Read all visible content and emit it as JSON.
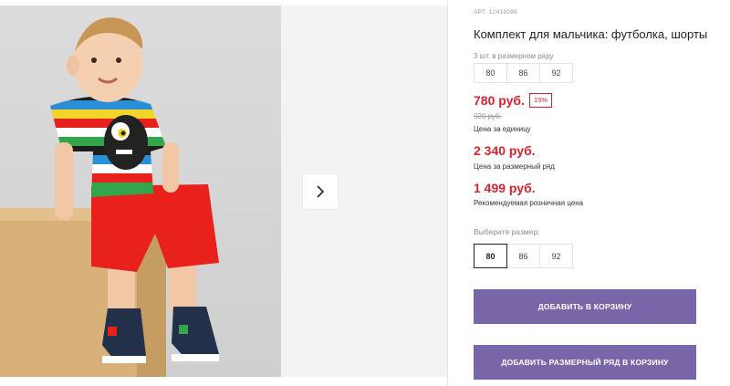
{
  "gallery": {
    "photo_alt": "Boy in striped monster t-shirt and red shorts",
    "next_icon": "chevron-right-icon"
  },
  "product": {
    "article": "АРТ. 12419098",
    "title": "Комплект для мальчика: футболка, шорты"
  },
  "size_row": {
    "caption": "3 шт. в размерном ряду",
    "sizes": [
      "80",
      "86",
      "92"
    ]
  },
  "prices": {
    "unit_price": "780 руб.",
    "discount_badge": "15%",
    "old_price": "920 руб.",
    "unit_caption": "Цена за единицу",
    "row_price": "2 340 руб.",
    "row_caption": "Цена за размерный ряд",
    "retail_price": "1 499 руб.",
    "retail_caption": "Рекомендуемая розничная цена"
  },
  "size_select": {
    "label": "Выберите размер:",
    "options": [
      "80",
      "86",
      "92"
    ],
    "selected": "80"
  },
  "actions": {
    "add_to_cart": "ДОБАВИТЬ В КОРЗИНУ",
    "add_row_to_cart": "ДОБАВИТЬ РАЗМЕРНЫЙ РЯД В КОРЗИНУ"
  },
  "colors": {
    "price_red": "#d9222e",
    "button_purple": "#7966a8"
  }
}
